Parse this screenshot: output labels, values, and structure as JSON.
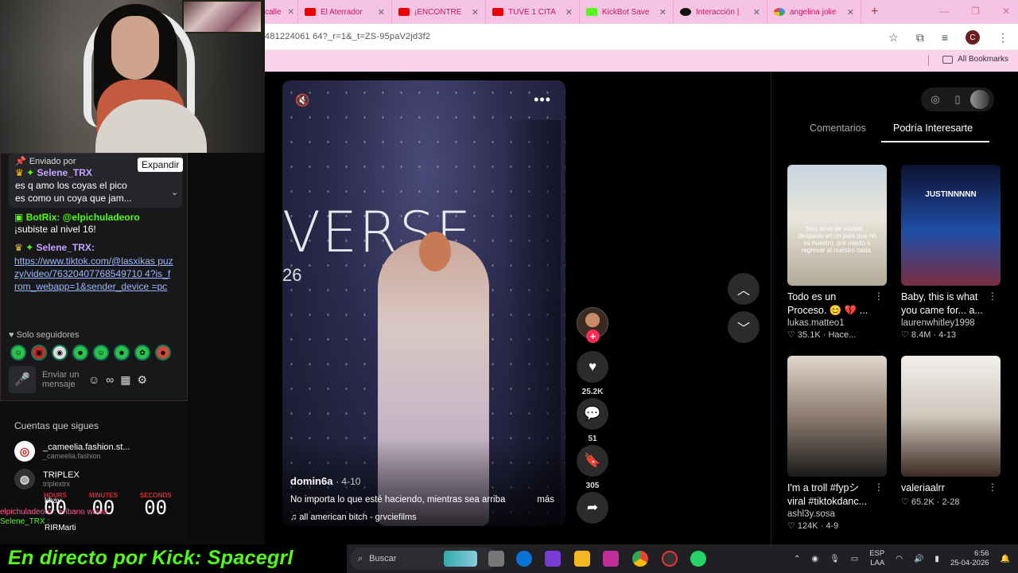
{
  "webcam": {
    "label": "webcam"
  },
  "chat": {
    "pinned_by": "Enviado por",
    "expand_tooltip": "Expandir",
    "pinned_user": "Selene_TRX",
    "pinned_text_1": "es q amo los coyas el pico",
    "pinned_text_2": "es como un coya que jam...",
    "msg1_user": "BotRix: @elpichuladeoro",
    "msg1_text": "¡subiste al nivel 16!",
    "msg2_user": "Selene_TRX:",
    "msg2_link": "https://www.tiktok.com/@lasxikas puzzy/video/76320407768549710 4?is_from_webapp=1&sender_device =pc",
    "followers_only": "Solo seguidores",
    "input_placeholder": "Enviar un mensaje"
  },
  "followed": {
    "title": "Cuentas que sigues",
    "items": [
      {
        "name": "_cameelia.fashion.st...",
        "sub": "_cameelia.fashion"
      },
      {
        "name": "TRIPLEX",
        "sub": "triplextrx"
      },
      {
        "name": "khay",
        "sub": ""
      },
      {
        "name": "RIRMarti",
        "sub": ""
      }
    ],
    "timer": {
      "hours_label": "HOURS",
      "hours": "00",
      "minutes_label": "MINUTES",
      "minutes": "00",
      "seconds_label": "SECONDS",
      "seconds": "00"
    },
    "overlay_lines": [
      "elpichuladeoro : eribano wawa",
      "Selene_TRX :"
    ]
  },
  "banner": {
    "text": "En directo por Kick: Spacegrl"
  },
  "browser": {
    "first_tab": "calle",
    "tabs": [
      {
        "label": "El Aterrador",
        "icon": "youtube-icon",
        "kind": "yt"
      },
      {
        "label": "¡ENCONTRE",
        "icon": "youtube-icon",
        "kind": "yt"
      },
      {
        "label": "TUVE 1 CITA",
        "icon": "youtube-icon",
        "kind": "yt"
      },
      {
        "label": "KickBot Save",
        "icon": "kick-icon",
        "kind": "kick"
      },
      {
        "label": "Interacción |",
        "icon": "tiktok-icon",
        "kind": "tt"
      },
      {
        "label": "angelina jolie",
        "icon": "google-icon",
        "kind": "g"
      }
    ],
    "url": "481224061 64?_r=1&_t=ZS-95paV2jd3f2",
    "bookmarks_label": "All Bookmarks",
    "profile_initial": "C"
  },
  "video": {
    "stage_text": "VERSE",
    "stage_year": "26",
    "author": "domin6a",
    "date": "· 4-10",
    "description": "No importa lo que esté haciendo, mientras sea arriba",
    "more": "más",
    "sound": "all american bitch - grvciefilms"
  },
  "actions": {
    "likes": "25.2K",
    "comments": "51",
    "saves": "305"
  },
  "panel": {
    "tab_comments": "Comentarios",
    "tab_suggested": "Podría Interesarte",
    "cards": [
      {
        "title": "Todo es un Proceso. 😊 💔 ...",
        "user": "lukas.matteo1",
        "stats": "♡ 35.1K · Hace...",
        "overlay": "Nos sirve de mantel... despacio en un país que no es nuestro, por miedo a regresar al nuestro nada."
      },
      {
        "title": "Baby, this is what you came for... a...",
        "user": "laurenwhitley1998",
        "stats": "♡ 8.4M · 4-13",
        "overlay": "JUSTINNNNN"
      },
      {
        "title": "I'm a troll #fypシ viral #tiktokdanc...",
        "user": "ashl3y.sosa",
        "stats": "♡ 124K · 4-9",
        "overlay": ""
      },
      {
        "title": "valeriaalrr",
        "user": "",
        "stats": "♡ 65.2K · 2-28",
        "overlay": ""
      }
    ]
  },
  "taskbar": {
    "search": "Buscar",
    "lang1": "ESP",
    "lang2": "LAA",
    "time": "6:56",
    "date": "25-04-2026"
  }
}
